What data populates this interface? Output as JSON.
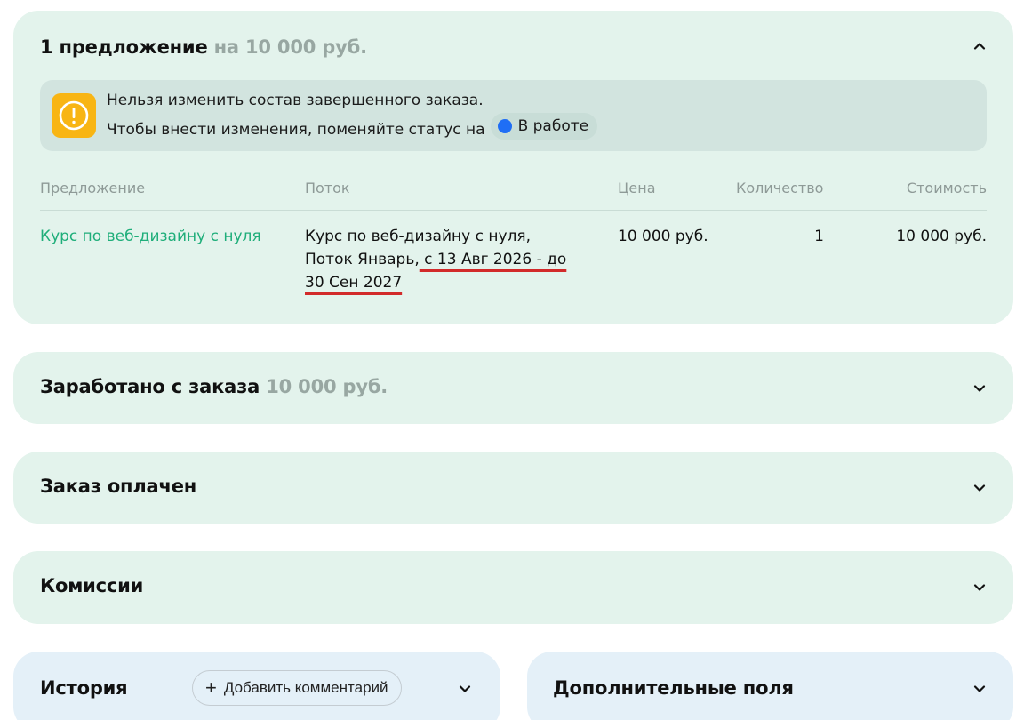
{
  "offers": {
    "title": "1 предложение",
    "total": "на 10 000 руб.",
    "notice": {
      "line1": "Нельзя изменить состав завершенного заказа.",
      "line2": "Чтобы внести изменения, поменяйте статус на",
      "status": "В работе",
      "status_color": "#1f6ef5"
    },
    "columns": {
      "offer": "Предложение",
      "stream": "Поток",
      "price": "Цена",
      "quantity": "Количество",
      "cost": "Стоимость"
    },
    "rows": [
      {
        "offer": "Курс по веб-дизайну с нуля",
        "stream_line1": "Курс по веб-дизайну с нуля,",
        "stream_line2_start": "Поток Январь,",
        "stream_line2_dates": " с 13 Авг 2026 - до",
        "stream_line3": "30 Сен 2027",
        "price": "10 000 руб.",
        "quantity": "1",
        "cost": "10 000 руб."
      }
    ]
  },
  "earned": {
    "title": "Заработано с заказа",
    "amount": "10 000 руб."
  },
  "paid": {
    "title": "Заказ оплачен"
  },
  "commissions": {
    "title": "Комиссии"
  },
  "history": {
    "title": "История",
    "add_comment_label": "Добавить комментарий"
  },
  "extra_fields": {
    "title": "Дополнительные поля"
  },
  "colors": {
    "card_green": "#e3f3ec",
    "card_blue": "#e4f0f8",
    "link_green": "#1fae7a",
    "warning": "#f8b514",
    "underline_red": "#d22a2a"
  }
}
